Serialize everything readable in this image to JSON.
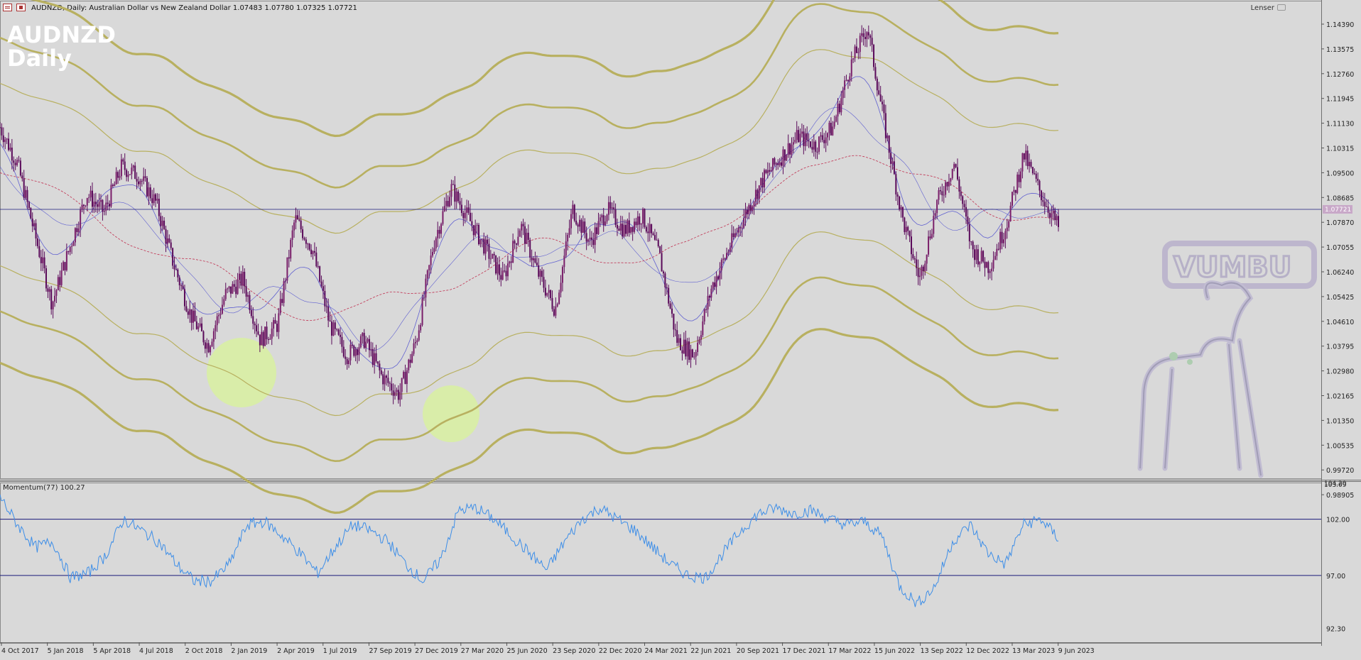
{
  "header": {
    "symbol_info": "AUDNZD, Daily:  Australian Dollar vs New Zealand Dollar  1.07483 1.07780 1.07325 1.07721",
    "indicator_name": "Lenser",
    "big_symbol": "AUDNZD",
    "big_timeframe": "Daily"
  },
  "price_axis": {
    "ticks": [
      "1.14390",
      "1.13575",
      "1.12760",
      "1.11945",
      "1.11130",
      "1.10315",
      "1.09500",
      "1.08685",
      "1.07870",
      "1.07055",
      "1.06240",
      "1.05425",
      "1.04610",
      "1.03795",
      "1.02980",
      "1.02165",
      "1.01350",
      "1.00535",
      "0.99720",
      "0.98905"
    ],
    "current_price": "1.07721"
  },
  "momentum": {
    "label": "Momentum(77) 100.27",
    "top_labels": [
      "104.20",
      "103.09"
    ],
    "ticks": [
      "102.00",
      "97.00",
      "92.30"
    ]
  },
  "time_axis": {
    "labels": [
      "4 Oct 2017",
      "5 Jan 2018",
      "5 Apr 2018",
      "4 Jul 2018",
      "2 Oct 2018",
      "2 Jan 2019",
      "2 Apr 2019",
      "1 Jul 2019",
      "27 Sep 2019",
      "27 Dec 2019",
      "27 Mar 2020",
      "25 Jun 2020",
      "23 Sep 2020",
      "22 Dec 2020",
      "24 Mar 2021",
      "22 Jun 2021",
      "20 Sep 2021",
      "17 Dec 2021",
      "17 Mar 2022",
      "15 Jun 2022",
      "13 Sep 2022",
      "12 Dec 2022",
      "13 Mar 2023",
      "9 Jun 2023"
    ]
  },
  "watermark": {
    "text": "VUMBU"
  },
  "colors": {
    "background": "#d9d9d9",
    "candle": "#5a0a5a",
    "band": "#b8b060",
    "momentum": "#3d8ee8",
    "level_line": "#1a1a7a",
    "highlight": "#d8f0a0",
    "ma_blue": "#6060d0",
    "ma_red": "#c03050"
  },
  "chart_data": [
    {
      "type": "line",
      "subtype": "candlestick",
      "title": "AUDNZD Daily",
      "x_labels": [
        "4 Oct 2017",
        "5 Jan 2018",
        "5 Apr 2018",
        "4 Jul 2018",
        "2 Oct 2018",
        "2 Jan 2019",
        "2 Apr 2019",
        "1 Jul 2019",
        "27 Sep 2019",
        "27 Dec 2019",
        "27 Mar 2020",
        "25 Jun 2020",
        "23 Sep 2020",
        "22 Dec 2020",
        "24 Mar 2021",
        "22 Jun 2021",
        "20 Sep 2021",
        "17 Dec 2021",
        "17 Mar 2022",
        "15 Jun 2022",
        "13 Sep 2022",
        "12 Dec 2022",
        "13 Mar 2023",
        "9 Jun 2023"
      ],
      "ylim": [
        0.984,
        1.151
      ],
      "series": [
        {
          "name": "Close",
          "values": [
            1.11,
            1.098,
            1.075,
            1.052,
            1.07,
            1.088,
            1.082,
            1.097,
            1.094,
            1.085,
            1.065,
            1.048,
            1.038,
            1.055,
            1.06,
            1.04,
            1.045,
            1.08,
            1.07,
            1.045,
            1.035,
            1.04,
            1.028,
            1.022,
            1.04,
            1.072,
            1.09,
            1.08,
            1.07,
            1.06,
            1.078,
            1.062,
            1.05,
            1.083,
            1.072,
            1.083,
            1.076,
            1.081,
            1.068,
            1.04,
            1.035,
            1.057,
            1.07,
            1.082,
            1.093,
            1.1,
            1.107,
            1.104,
            1.11,
            1.13,
            1.143,
            1.11,
            1.08,
            1.06,
            1.085,
            1.098,
            1.07,
            1.064,
            1.078,
            1.101,
            1.088,
            1.077
          ]
        }
      ]
    },
    {
      "type": "line",
      "title": "Momentum(77) 100.27",
      "ylim": [
        91.5,
        104.5
      ],
      "series": [
        {
          "name": "Momentum(77)",
          "values": [
            104.0,
            101.5,
            99.5,
            100.0,
            96.8,
            97.2,
            98.8,
            102.0,
            101.0,
            100.0,
            98.0,
            96.5,
            96.5,
            98.0,
            101.5,
            101.8,
            100.5,
            99.0,
            97.2,
            99.5,
            101.5,
            101.0,
            100.0,
            98.0,
            96.5,
            98.5,
            102.8,
            103.0,
            102.0,
            100.5,
            99.0,
            97.5,
            100.0,
            102.0,
            103.0,
            102.0,
            101.0,
            99.5,
            98.0,
            97.0,
            96.8,
            99.0,
            101.0,
            102.5,
            103.0,
            102.5,
            102.8,
            102.0,
            101.5,
            101.8,
            100.5,
            96.0,
            94.5,
            96.0,
            100.0,
            101.5,
            99.0,
            98.0,
            101.5,
            102.0,
            100.3
          ]
        }
      ]
    }
  ]
}
